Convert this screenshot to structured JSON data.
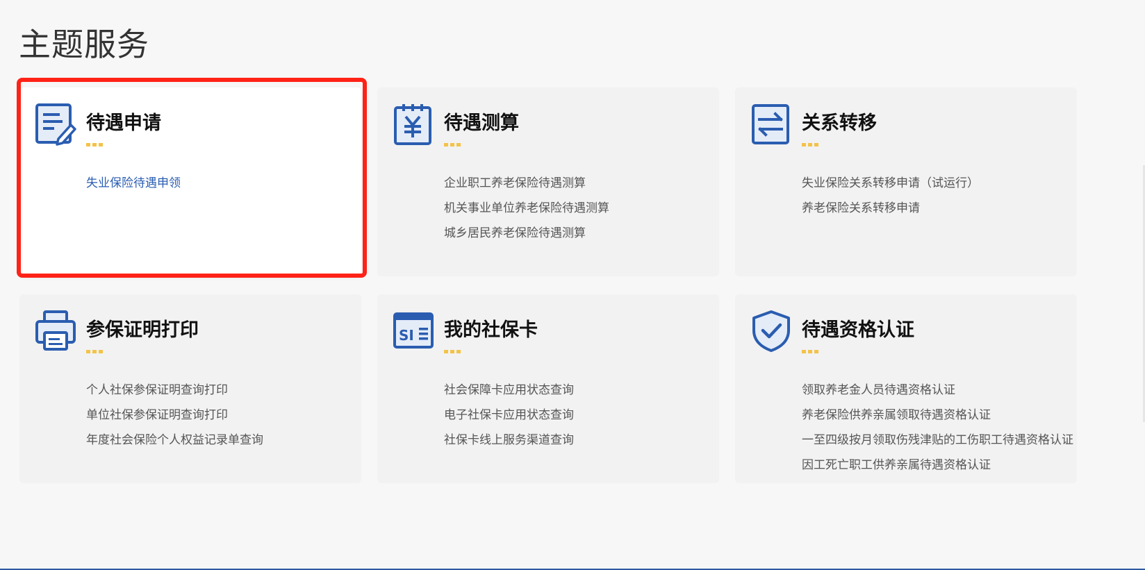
{
  "page_title": "主题服务",
  "colors": {
    "icon_blue": "#2a5db0",
    "dot_yellow": "#f4c247",
    "highlight_red": "#ff2217"
  },
  "cards": [
    {
      "title": "待遇申请",
      "icon": "form-edit-icon",
      "links": [
        "失业保险待遇申领"
      ]
    },
    {
      "title": "待遇测算",
      "icon": "yuan-calculator-icon",
      "links": [
        "企业职工养老保险待遇测算",
        "机关事业单位养老保险待遇测算",
        "城乡居民养老保险待遇测算"
      ]
    },
    {
      "title": "关系转移",
      "icon": "transfer-arrows-icon",
      "links": [
        "失业保险关系转移申请（试运行）",
        "养老保险关系转移申请"
      ]
    },
    {
      "title": "参保证明打印",
      "icon": "printer-icon",
      "links": [
        "个人社保参保证明查询打印",
        "单位社保参保证明查询打印",
        "年度社会保险个人权益记录单查询"
      ]
    },
    {
      "title": "我的社保卡",
      "icon": "social-security-card-icon",
      "links": [
        "社会保障卡应用状态查询",
        "电子社保卡应用状态查询",
        "社保卡线上服务渠道查询"
      ]
    },
    {
      "title": "待遇资格认证",
      "icon": "shield-check-icon",
      "links": [
        "领取养老金人员待遇资格认证",
        "养老保险供养亲属领取待遇资格认证",
        "一至四级按月领取伤残津贴的工伤职工待遇资格认证",
        "因工死亡职工供养亲属待遇资格认证"
      ]
    }
  ]
}
